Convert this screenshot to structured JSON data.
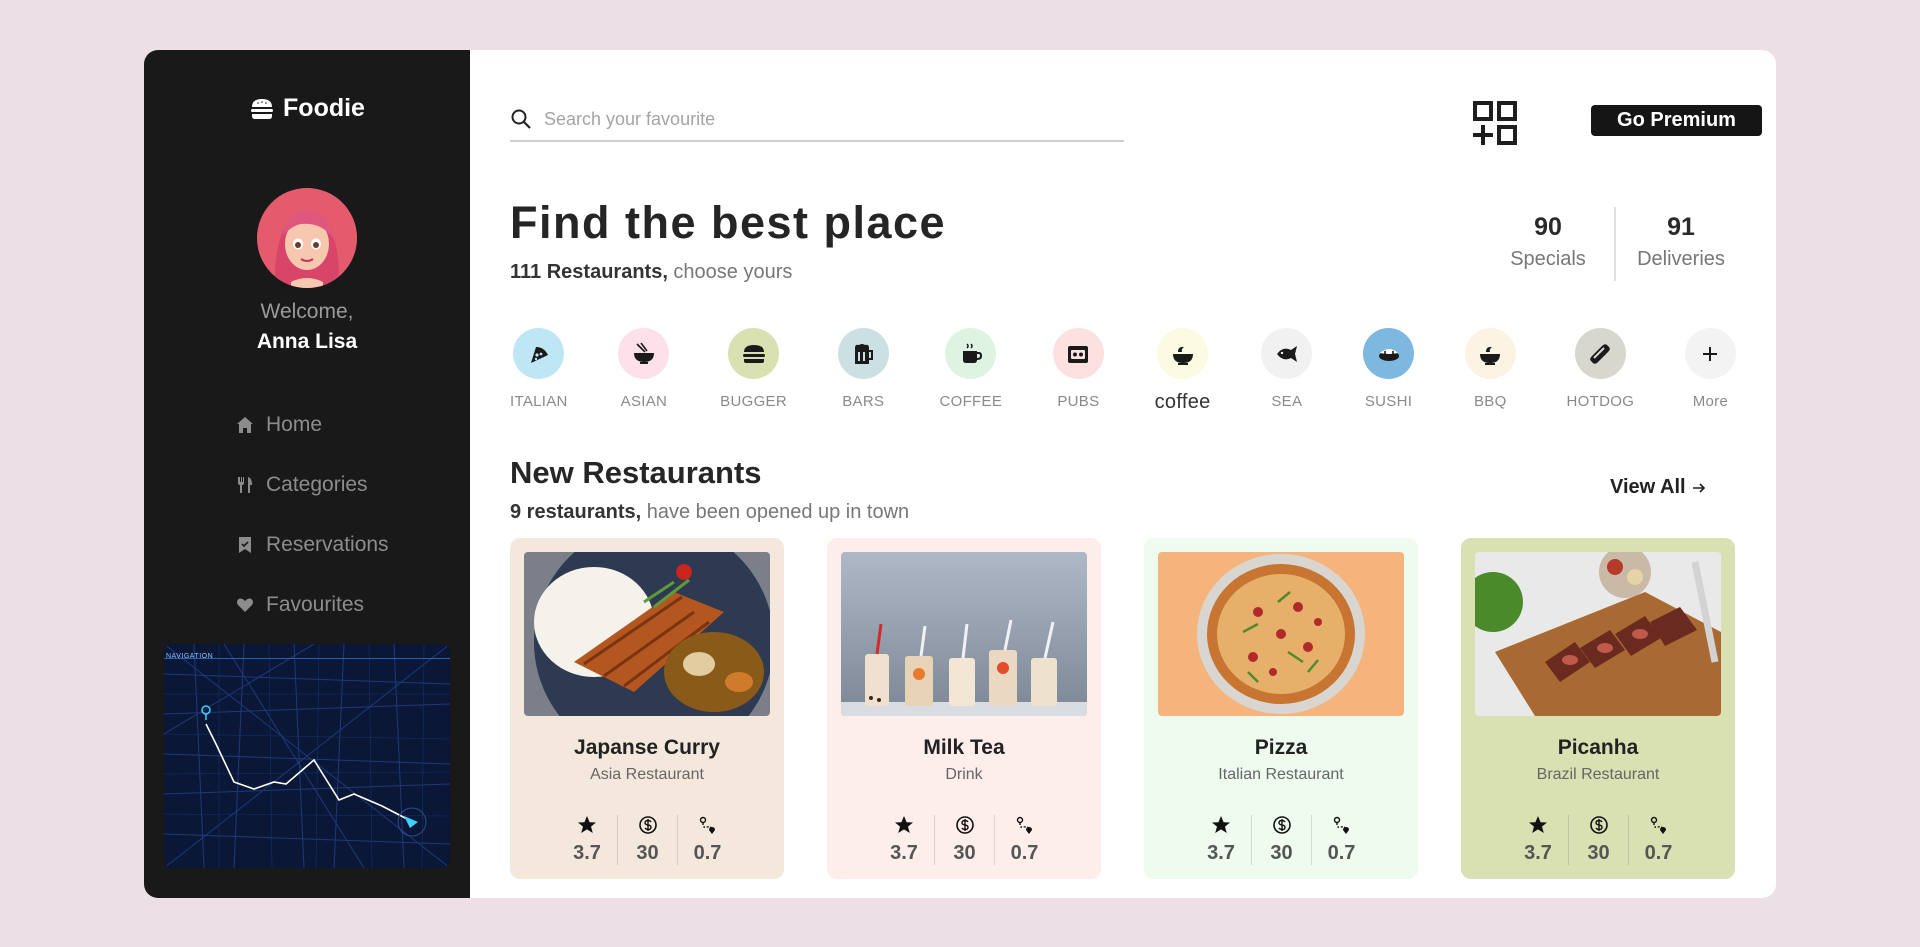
{
  "colors": {
    "page_bg": "#ece0e6",
    "sidebar_bg": "#191919",
    "accent_dark": "#151515"
  },
  "sidebar": {
    "logo_text": "Foodie",
    "welcome": "Welcome,",
    "user_name": "Anna Lisa",
    "nav": [
      {
        "label": "Home",
        "icon": "home-icon"
      },
      {
        "label": "Categories",
        "icon": "utensils-icon"
      },
      {
        "label": "Reservations",
        "icon": "bookmark-icon"
      },
      {
        "label": "Favourites",
        "icon": "heart-icon"
      }
    ],
    "map_label": "NAVIGATION"
  },
  "header": {
    "search_placeholder": "Search your favourite",
    "premium_label": "Go Premium"
  },
  "hero": {
    "title": "Find the best place",
    "count_bold": "111 Restaurants,",
    "count_rest": " choose yours"
  },
  "stats": [
    {
      "value": "90",
      "label": "Specials"
    },
    {
      "value": "91",
      "label": "Deliveries"
    }
  ],
  "categories": [
    {
      "label": "ITALIAN",
      "icon": "pizza-icon",
      "bg": "#bfe6f5"
    },
    {
      "label": "ASIAN",
      "icon": "bowl-icon",
      "bg": "#fde0ea"
    },
    {
      "label": "BUGGER",
      "icon": "burger-icon",
      "bg": "#d9e1b2"
    },
    {
      "label": "BARS",
      "icon": "beer-icon",
      "bg": "#cbe0e3"
    },
    {
      "label": "COFFEE",
      "icon": "coffee-icon",
      "bg": "#dff3e2"
    },
    {
      "label": "PUBS",
      "icon": "pub-icon",
      "bg": "#fde0e0"
    },
    {
      "label": "coffee",
      "icon": "cup-icon",
      "bg": "#fbfbe2"
    },
    {
      "label": "SEA",
      "icon": "fish-icon",
      "bg": "#f1f1f1"
    },
    {
      "label": "SUSHI",
      "icon": "sushi-icon",
      "bg": "#7cb8e0"
    },
    {
      "label": "BBQ",
      "icon": "bbq-icon",
      "bg": "#fdf3e2"
    },
    {
      "label": "HOTDOG",
      "icon": "hotdog-icon",
      "bg": "#d7d7d0"
    },
    {
      "label": "More",
      "icon": "plus-icon",
      "bg": "#f3f3f3"
    }
  ],
  "new_restaurants": {
    "title": "New Restaurants",
    "count_bold": "9 restaurants,",
    "count_rest": " have been opened up in town",
    "view_all": "View All"
  },
  "restaurants": [
    {
      "name": "Japanse Curry",
      "type": "Asia Restaurant",
      "bg": "#f4e8dc",
      "rating": "3.7",
      "price": "30",
      "distance": "0.7"
    },
    {
      "name": "Milk Tea",
      "type": "Drink",
      "bg": "#fdeeec",
      "rating": "3.7",
      "price": "30",
      "distance": "0.7"
    },
    {
      "name": "Pizza",
      "type": "Italian Restaurant",
      "bg": "#eefbee",
      "rating": "3.7",
      "price": "30",
      "distance": "0.7"
    },
    {
      "name": "Picanha",
      "type": "Brazil Restaurant",
      "bg": "#d9e1b2",
      "rating": "3.7",
      "price": "30",
      "distance": "0.7"
    }
  ]
}
